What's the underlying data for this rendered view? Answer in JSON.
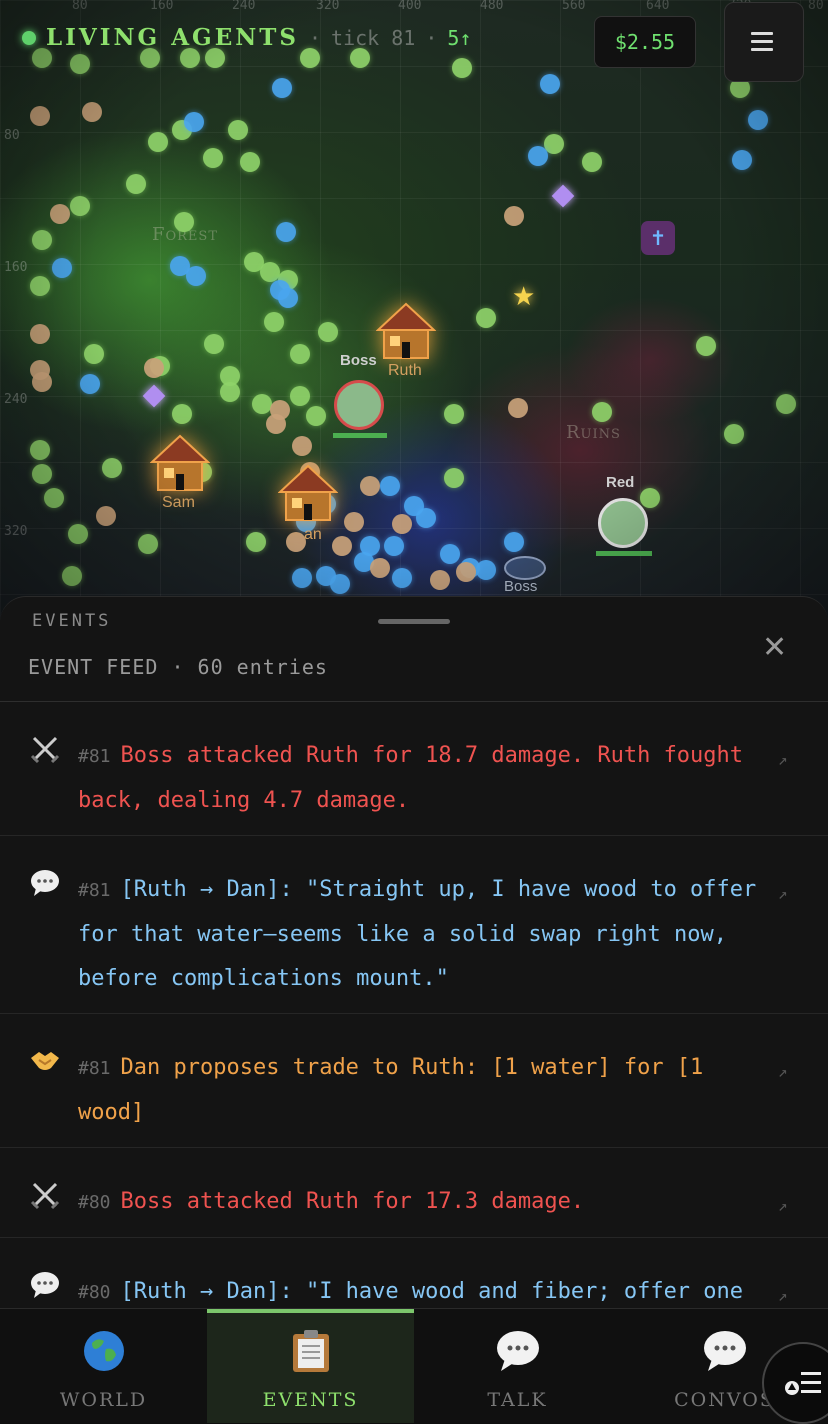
{
  "app": {
    "title": "LIVING AGENTS",
    "tick_label": "tick 81",
    "speed": "5↑",
    "money": "$2.55"
  },
  "map": {
    "x_ticks": [
      "80",
      "160",
      "240",
      "320",
      "400",
      "480",
      "560",
      "640",
      "720",
      "80"
    ],
    "y_ticks": [
      "80",
      "160",
      "240",
      "320"
    ],
    "regions": [
      "Forest",
      "Ruins"
    ],
    "houses": [
      "Ruth",
      "Sam",
      "an"
    ],
    "agents": [
      {
        "name": "Boss"
      },
      {
        "name": "Red"
      },
      {
        "name": "Boss"
      }
    ]
  },
  "events_panel": {
    "title": "EVENTS",
    "feed_title": "EVENT FEED · 60 entries",
    "close": "✕",
    "items": [
      {
        "type": "attack",
        "tick": "#81",
        "text": "Boss attacked Ruth for 18.7 damage. Ruth fought back, dealing 4.7 damage."
      },
      {
        "type": "talk",
        "tick": "#81",
        "text": "[Ruth → Dan]: \"Straight up, I have wood to offer for that water—seems like a solid swap right now, before complications mount.\""
      },
      {
        "type": "trade",
        "tick": "#81",
        "text": "Dan proposes trade to Ruth: [1 water] for [1 wood]"
      },
      {
        "type": "attack",
        "tick": "#80",
        "text": "Boss attacked Ruth for 17.3 damage."
      },
      {
        "type": "talk",
        "tick": "#80",
        "text": "[Ruth → Dan]: \"I have wood and fiber; offer one wood for that water, if you're still interested—seems a fair swap before things get"
      }
    ],
    "ext_glyph": "↗"
  },
  "tabs": [
    {
      "label": "WORLD",
      "icon": "globe-icon"
    },
    {
      "label": "EVENTS",
      "icon": "clipboard-icon",
      "active": true
    },
    {
      "label": "TALK",
      "icon": "speech-bubble-icon"
    },
    {
      "label": "CONVOS",
      "icon": "speech-bubble-icon"
    }
  ],
  "colors": {
    "accent": "#8ee06d",
    "attack": "#ef5350",
    "talk": "#86c6f4",
    "trade": "#f0a24a"
  }
}
